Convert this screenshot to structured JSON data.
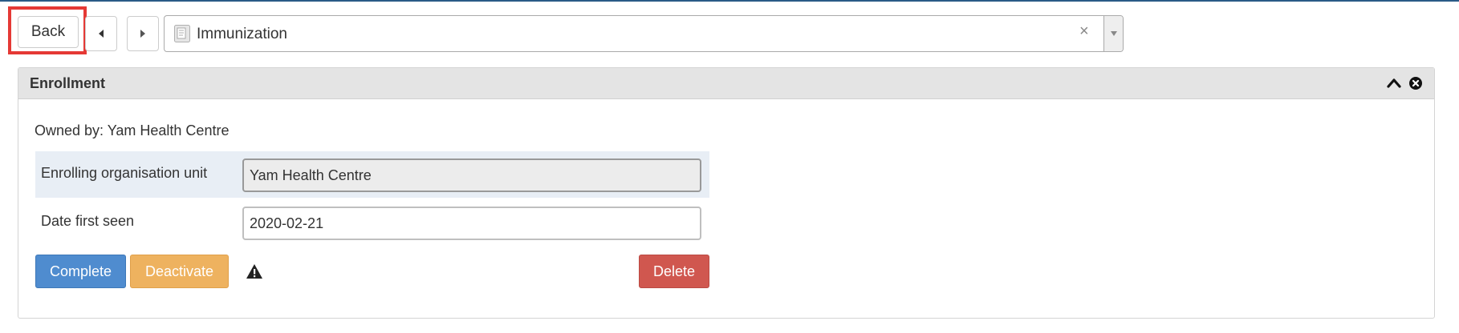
{
  "toolbar": {
    "back_label": "Back",
    "prev_icon": "caret-left-icon",
    "next_icon": "caret-right-icon"
  },
  "program_select": {
    "icon": "program-form-icon",
    "selected": "Immunization",
    "clear_icon": "×",
    "arrow_icon": "caret-down-icon"
  },
  "panel": {
    "title": "Enrollment",
    "collapse_icon": "chevron-up-icon",
    "close_icon": "close-circle-icon",
    "owned_by": "Owned by: Yam Health Centre",
    "fields": [
      {
        "label": "Enrolling organisation unit",
        "value": "Yam Health Centre",
        "readonly": true
      },
      {
        "label": "Date first seen",
        "value": "2020-02-21",
        "readonly": false
      }
    ],
    "buttons": {
      "complete": "Complete",
      "deactivate": "Deactivate",
      "delete": "Delete"
    },
    "warning_icon": "warning-icon"
  },
  "colors": {
    "highlight": "#e53935",
    "complete": "#4f8ccf",
    "deactivate": "#eeb25f",
    "delete": "#d0574f",
    "panel_heading": "#e4e4e4",
    "row_highlight": "#e8eef5"
  }
}
